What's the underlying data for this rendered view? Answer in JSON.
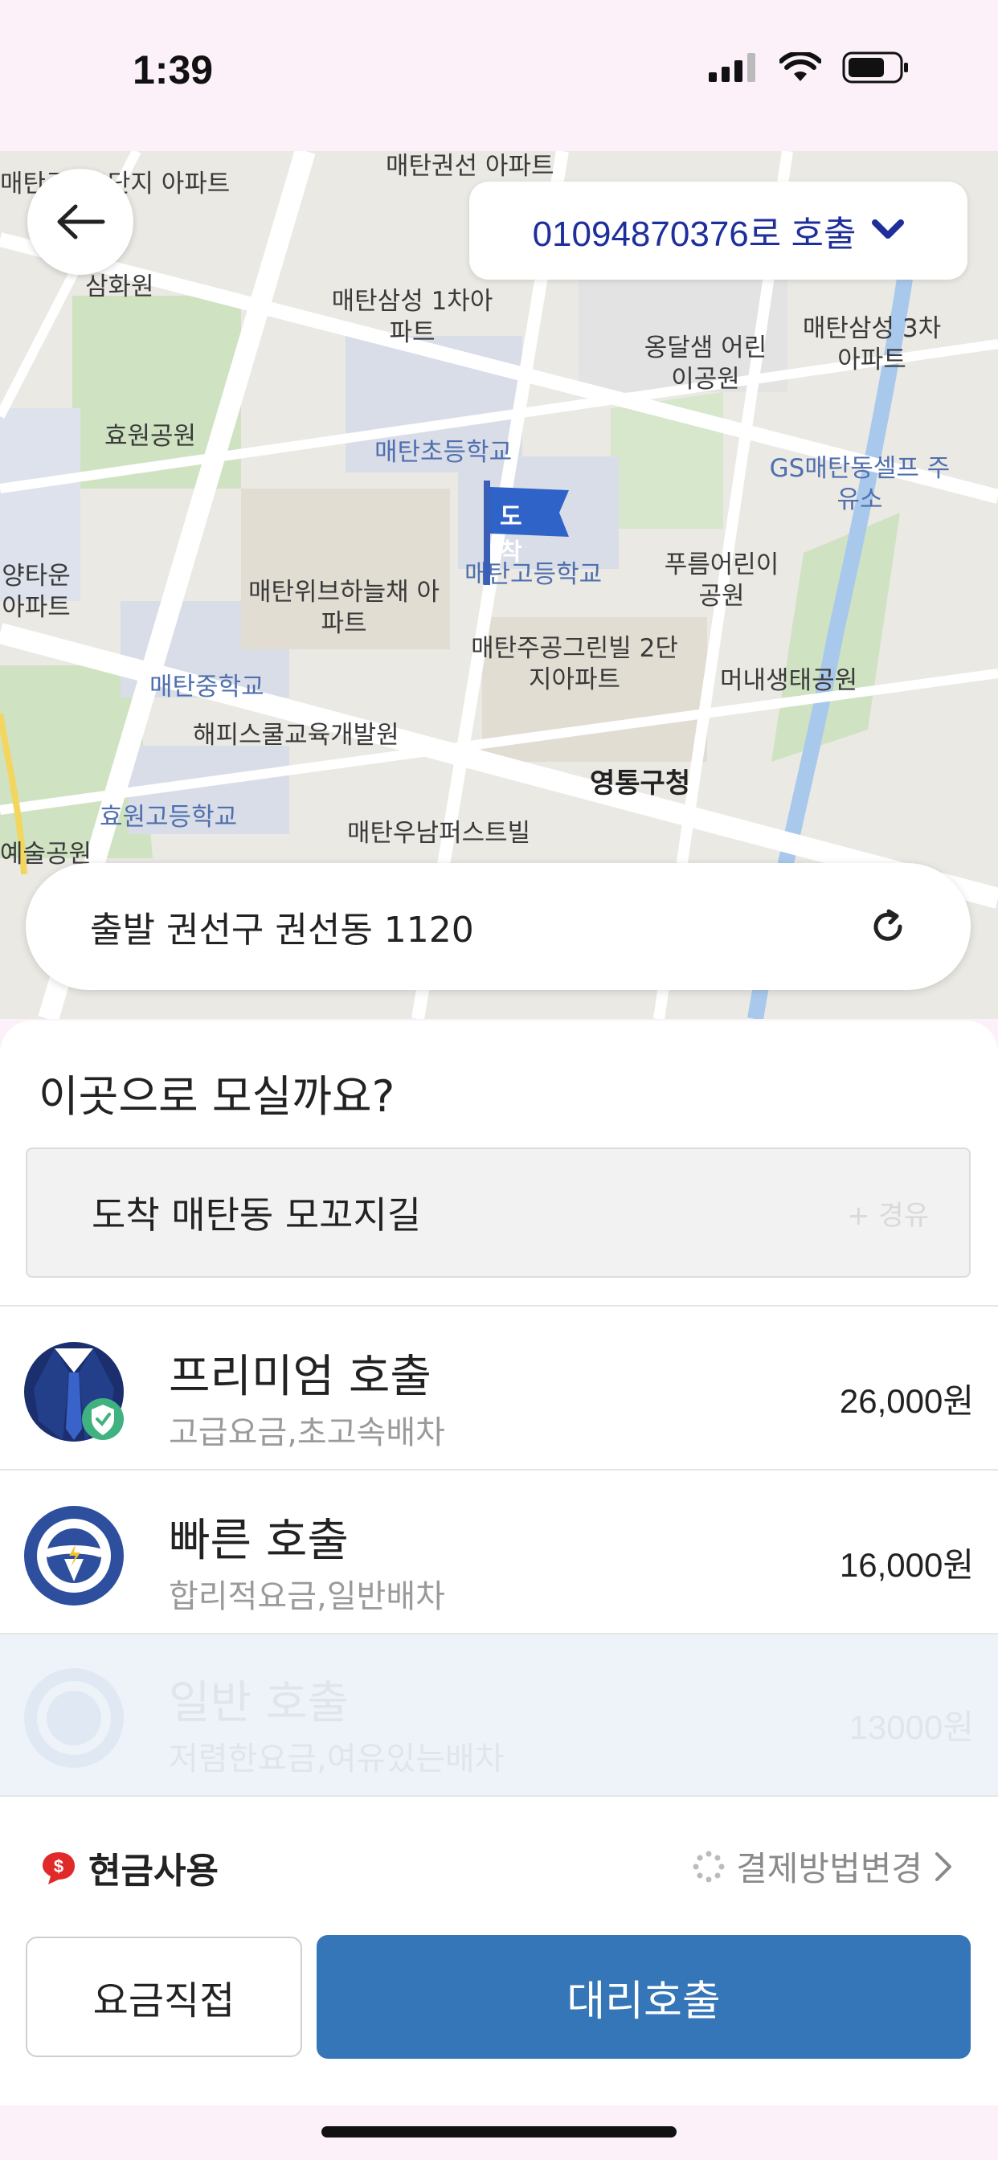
{
  "status": {
    "time": "1:39"
  },
  "header": {
    "call_number_label": "01094870376로 호출"
  },
  "map": {
    "labels": [
      "매탄주공5단지 아파트",
      "매탄권선 아파트",
      "삼화원",
      "매탄삼성 1차아파트",
      "옹달샘 어린이공원",
      "매탄삼성 3차아파트",
      "효원공원",
      "매탄초등학교",
      "GS매탄동셀프 주유소",
      "양타운 아파트",
      "매탄위브하늘채 아파트",
      "매탄고등학교",
      "푸름어린이 공원",
      "매탄주공그린빌 2단지아파트",
      "머내생태공원",
      "매탄중학교",
      "해피스쿨교육개발원",
      "영통구청",
      "효원고등학교",
      "예술공원",
      "매탄우남퍼스트빌"
    ],
    "destination_flag": "도착"
  },
  "origin": {
    "text": "출발 권선구 권선동 1120"
  },
  "sheet": {
    "title": "이곳으로 모실까요?",
    "destination_text": "도착 매탄동 모꼬지길",
    "destination_hint": "+ 경유"
  },
  "options": [
    {
      "title": "프리미엄 호출",
      "subtitle": "고급요금,초고속배차",
      "price": "26,000원"
    },
    {
      "title": "빠른 호출",
      "subtitle": "합리적요금,일반배차",
      "price": "16,000원"
    },
    {
      "title": "일반 호출",
      "subtitle": "저렴한요금,여유있는배차",
      "price": "13000원"
    }
  ],
  "payment": {
    "method": "현금사용",
    "change_label": "결제방법변경"
  },
  "buttons": {
    "fare_direct": "요금직접",
    "call_driver": "대리호출"
  },
  "colors": {
    "accent": "#3576b8",
    "pill_text": "#1e2f9c",
    "status_bg": "#fcf1f8"
  }
}
